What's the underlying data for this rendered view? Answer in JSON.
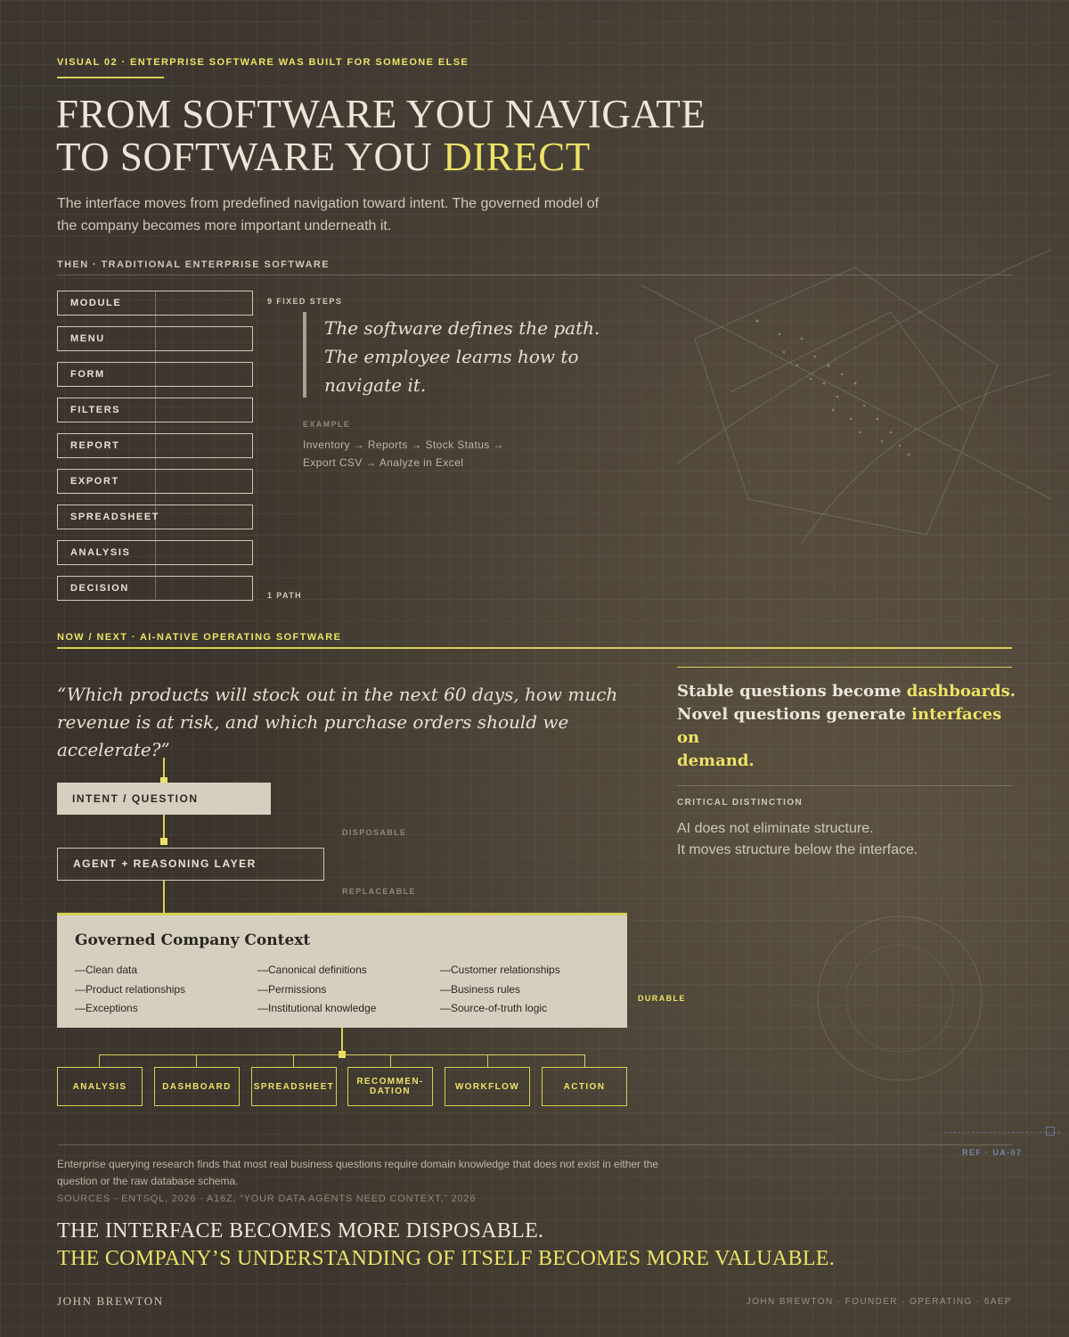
{
  "header": {
    "kicker": "VISUAL 02 · ENTERPRISE SOFTWARE WAS BUILT FOR SOMEONE ELSE",
    "title_line1": "FROM SOFTWARE YOU NAVIGATE",
    "title_line2_prefix": "TO SOFTWARE YOU ",
    "title_line2_highlight": "DIRECT",
    "subtitle_line1": "The interface moves from predefined navigation toward intent. The governed model of",
    "subtitle_line2": "the company becomes more important underneath it."
  },
  "then": {
    "label": "THEN · TRADITIONAL ENTERPRISE SOFTWARE",
    "steps": [
      "MODULE",
      "MENU",
      "FORM",
      "FILTERS",
      "REPORT",
      "EXPORT",
      "SPREADSHEET",
      "ANALYSIS",
      "DECISION"
    ],
    "steps_count_label": "9 FIXED STEPS",
    "path_label": "1 PATH",
    "quote_line1": "The software defines the path.",
    "quote_line2": "The employee learns how to",
    "quote_line3": "navigate it.",
    "example_label": "EXAMPLE",
    "example_line1": "Inventory → Reports → Stock Status →",
    "example_line2": "Export CSV → Analyze in Excel"
  },
  "now": {
    "label": "NOW / NEXT · AI-NATIVE OPERATING SOFTWARE",
    "question_line1": "“Which products will stock out in the next 60 days, how much",
    "question_line2": "revenue is at risk, and which purchase orders should we",
    "question_line3": "accelerate?”",
    "intent_box": "INTENT / QUESTION",
    "agent_box": "AGENT + REASONING LAYER",
    "disposable_label": "DISPOSABLE",
    "replaceable_label": "REPLACEABLE",
    "durable_label": "DURABLE",
    "context": {
      "title": "Governed Company Context",
      "items": [
        "—Clean data",
        "—Canonical definitions",
        "—Customer relationships",
        "—Product relationships",
        "—Permissions",
        "—Business rules",
        "—Exceptions",
        "—Institutional knowledge",
        "—Source-of-truth logic"
      ]
    },
    "outputs": [
      "ANALYSIS",
      "DASHBOARD",
      "SPREADSHEET",
      "RECOMMEN-\nDATION",
      "WORKFLOW",
      "ACTION"
    ],
    "side": {
      "line1_prefix": "Stable questions become ",
      "line1_highlight": "dashboards.",
      "line2_prefix": "Novel questions generate ",
      "line2_highlight": "interfaces on",
      "line3_highlight": "demand.",
      "distinction_label": "CRITICAL DISTINCTION",
      "distinction_line1": "AI does not eliminate structure.",
      "distinction_line2": "It moves structure below the interface."
    }
  },
  "footer": {
    "ref": "REF · UA-07",
    "research_line1": "Enterprise querying research finds that most real business questions require domain knowledge that does not exist in either the",
    "research_line2": "question or the raw database schema.",
    "sources": "SOURCES · ENTSQL, 2026 · A16Z, “YOUR DATA AGENTS NEED CONTEXT,” 2026",
    "closing_line1": "THE INTERFACE BECOMES MORE DISPOSABLE.",
    "closing_line2": "THE COMPANY’S UNDERSTANDING OF ITSELF BECOMES MORE VALUABLE.",
    "author": "JOHN BREWTON",
    "credit": "JOHN BREWTON · FOUNDER · OPERATING · 6AEP"
  },
  "colors": {
    "accent": "#ece267",
    "background": "#3b352e",
    "panel": "#d6cfbf"
  }
}
